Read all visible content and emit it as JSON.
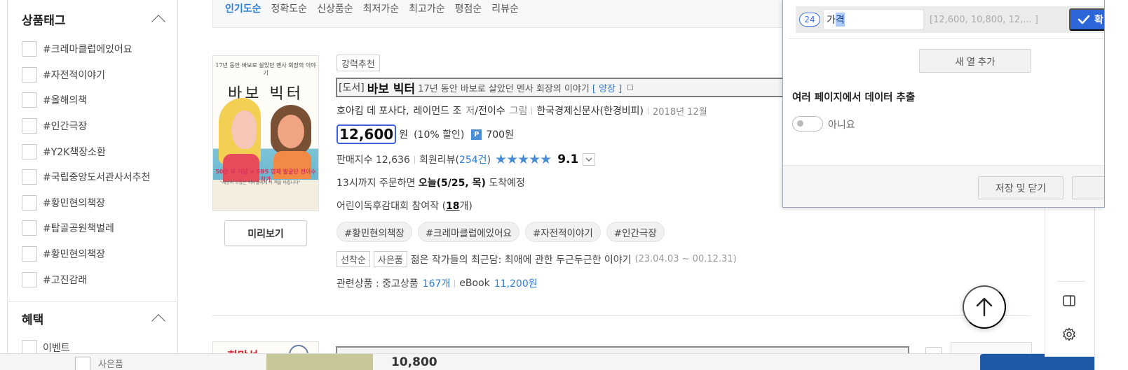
{
  "sidebar": {
    "tag_section_title": "상품태그",
    "tags": [
      "#크레마클럽에있어요",
      "#자전적이야기",
      "#올해의책",
      "#인간극장",
      "#Y2K책장소환",
      "#국립중앙도서관사서추천",
      "#황민현의책장",
      "#탑골공원책벌레",
      "#황민현의책장",
      "#고진감래"
    ],
    "benefit_section_title": "혜택",
    "benefits": [
      "이벤트"
    ]
  },
  "sort": {
    "items": [
      "인기도순",
      "정확도순",
      "신상품순",
      "최저가순",
      "최고가순",
      "평점순",
      "리뷰순"
    ],
    "active": "인기도순"
  },
  "product": {
    "recommend_badge": "강력추천",
    "category": "[도서]",
    "title": "바보 빅터",
    "subtitle": "17년 동안 바보로 살았던 멘사 회장의 이야기",
    "binding": "[ 양장 ]",
    "author1": "호아킴 데 포사다",
    "author_sep": ",",
    "author2": "레이먼드 조",
    "author_role": "저",
    "translator": "/전이수",
    "illust_role": "그림",
    "publisher": "한국경제신문사(한경비피)",
    "pub_date": "2018년 12월",
    "price": "12,600",
    "price_unit": "원",
    "discount": "(10% 할인)",
    "point_icon": "P",
    "point": "700원",
    "sales_index_label": "판매지수 12,636",
    "review_label": "회원리뷰(",
    "review_count": "254건",
    "review_close": ")",
    "stars": "★★★★★",
    "rating": "9.1",
    "delivery_prefix": "13시까지 주문하면",
    "delivery_day": "오늘(5/25, 목)",
    "delivery_suffix": "도착예정",
    "contest_prefix": "어린이독후감대회 참여작 (",
    "contest_count": "18",
    "contest_suffix": "개)",
    "chips": [
      "#황민현의책장",
      "#크레마클럽에있어요",
      "#자전적이야기",
      "#인간극장"
    ],
    "event_badges": [
      "선착순",
      "사은품"
    ],
    "event_text": "젊은 작가들의 최근담: 최애에 관한 두근두근한 이야기",
    "event_date": "(23.04.03 ~ 00.12.31)",
    "related_label": "관련상품 : 중고상품",
    "related_used": "167개",
    "ebook_label": "eBook",
    "ebook_price": "11,200원",
    "preview_button": "미리보기",
    "cover": {
      "top_text": "17년 동안 바보로 살았던 멘사 회장의 이야기",
      "title": "바보 빅터",
      "band": "50만 부 기념 × SBS 영재 발굴단 전이수 작가",
      "quote": "\"세상의 수많은 빅터들에게 이 책을 바칩니다\""
    }
  },
  "next_product": {
    "cover_text": "희망선",
    "price": "10,800"
  },
  "background_strip": {
    "ghost_text": "사은품"
  },
  "panel": {
    "column_number": "24",
    "column_name_plain": "가",
    "column_name_selected": "격",
    "column_preview": "[12,600, 10,800, 12,...  ]",
    "confirm_label": "확",
    "add_column_button": "새 열 추가",
    "multi_page_title": "여러 페이지에서 데이터 추출",
    "toggle_label": "아니요",
    "save_close_button": "저장 및 닫기"
  },
  "icons": {
    "scroll_top": "arrow-up-icon",
    "sidebar_toggle": "sidebar-panel-icon",
    "settings": "gear-icon",
    "confirm": "check-icon"
  },
  "colors": {
    "accent_blue": "#2e7dd7",
    "confirm_blue": "#2c66d8",
    "star_blue": "#4a8fd6"
  }
}
